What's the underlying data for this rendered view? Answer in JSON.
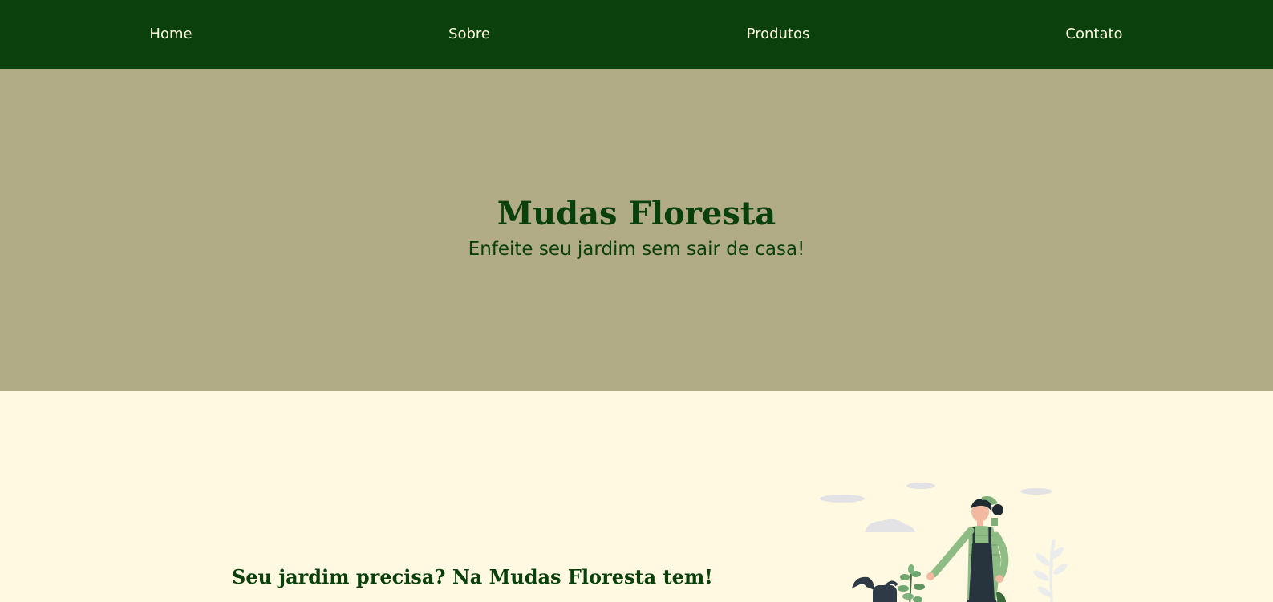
{
  "nav": {
    "items": [
      {
        "label": "Home"
      },
      {
        "label": "Sobre"
      },
      {
        "label": "Produtos"
      },
      {
        "label": "Contato"
      }
    ]
  },
  "hero": {
    "title": "Mudas Floresta",
    "subtitle": "Enfeite seu jardim sem sair de casa!"
  },
  "about": {
    "heading": "Seu jardim precisa? Na Mudas Floresta tem!",
    "illustration_icon": "gardener-with-plants-illustration"
  },
  "colors": {
    "nav_bg": "#0a400c",
    "hero_bg": "#b1ab86",
    "page_bg": "#fef9e0",
    "brand_green": "#0a400c"
  }
}
